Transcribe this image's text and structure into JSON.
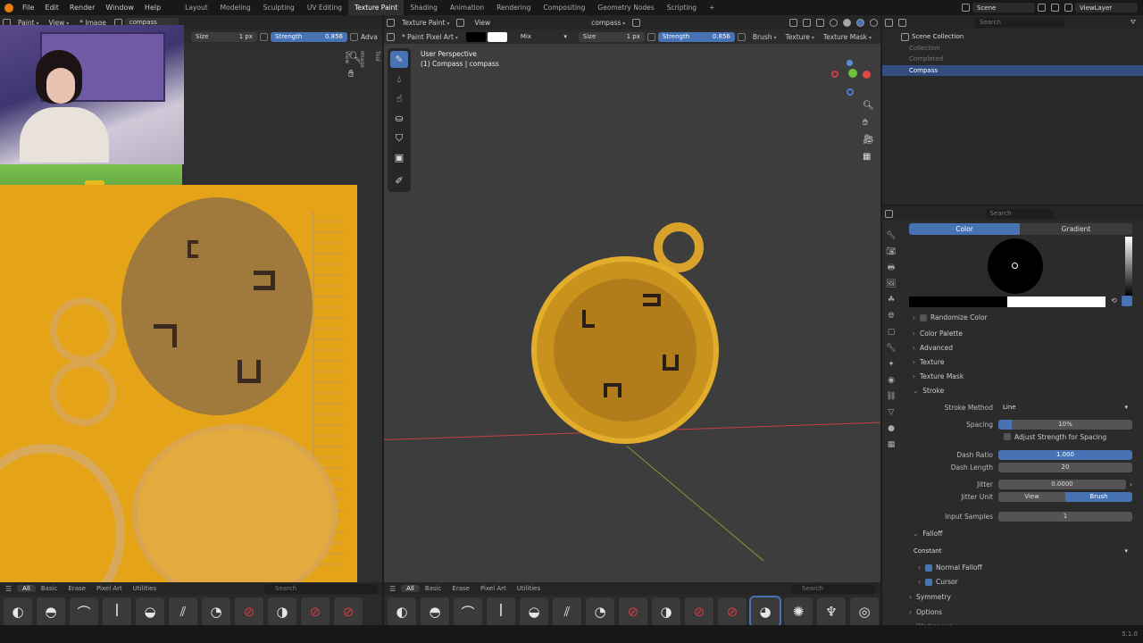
{
  "menu": [
    "File",
    "Edit",
    "Render",
    "Window",
    "Help"
  ],
  "workspaces": [
    "Layout",
    "Modeling",
    "Sculpting",
    "UV Editing",
    "Texture Paint",
    "Shading",
    "Animation",
    "Rendering",
    "Compositing",
    "Geometry Nodes",
    "Scripting"
  ],
  "active_workspace": "Texture Paint",
  "add_workspace": "+",
  "scene": "Scene",
  "view_layer": "ViewLayer",
  "image_editor": {
    "mode": "Paint",
    "view_menu": "View",
    "image_menu": "* Image",
    "image_name": "compass",
    "size_label": "Size",
    "size_value": "1 px",
    "strength_label": "Strength",
    "strength_value": "0.856",
    "adva_label": "Adva",
    "side_tabs": [
      "Tool",
      "Image",
      "View"
    ],
    "shelf_tabs": [
      "All",
      "Basic",
      "Erase",
      "Pixel Art",
      "Utilities"
    ],
    "search_placeholder": "Search",
    "brushes": [
      "brush-round",
      "brush-soft",
      "brush-hard",
      "brush-draw",
      "brush-airbrush",
      "brush-streak",
      "brush-smear",
      "brush-erase-hard",
      "brush-erase-soft",
      "brush-erase-pixel",
      "brush-erase-line"
    ]
  },
  "viewport": {
    "mode": "Texture Paint",
    "view_menu": "View",
    "object_dropdown": "compass",
    "brush_name": "* Paint Pixel Art",
    "blend": "Mix",
    "size_label": "Size",
    "size_value": "1 px",
    "strength_label": "Strength",
    "strength_value": "0.856",
    "brush_menu": "Brush",
    "texture_menu": "Texture",
    "texture_mask_menu": "Texture Mask",
    "overlay_title": "User Perspective",
    "overlay_sub": "(1) Compass | compass",
    "shelf_tabs": [
      "All",
      "Basic",
      "Erase",
      "Pixel Art",
      "Utilities"
    ],
    "search_placeholder": "Search",
    "brushes": [
      "brush-round",
      "brush-soft",
      "brush-hard",
      "brush-draw",
      "brush-airbrush",
      "brush-streak",
      "brush-smear",
      "brush-erase-hard",
      "brush-erase-soft",
      "brush-erase-pixel",
      "brush-erase-line",
      "brush-pixel-art",
      "brush-clone",
      "brush-fill",
      "brush-mask"
    ]
  },
  "outliner": {
    "search_placeholder": "Search",
    "root": "Scene Collection",
    "items": [
      "Collection",
      "Completed",
      "Compass"
    ]
  },
  "properties": {
    "search_placeholder": "Search",
    "color_tab": "Color",
    "gradient_tab": "Gradient",
    "randomize_color": "Randomize Color",
    "sections": [
      "Color Palette",
      "Advanced",
      "Texture",
      "Texture Mask"
    ],
    "stroke": "Stroke",
    "stroke_method_label": "Stroke Method",
    "stroke_method": "Line",
    "spacing_label": "Spacing",
    "spacing": "10%",
    "adjust_strength": "Adjust Strength for Spacing",
    "dash_ratio_label": "Dash Ratio",
    "dash_ratio": "1.000",
    "dash_length_label": "Dash Length",
    "dash_length": "20",
    "jitter_label": "Jitter",
    "jitter": "0.0000",
    "jitter_unit_label": "Jitter Unit",
    "jitter_unit_view": "View",
    "jitter_unit_brush": "Brush",
    "input_samples_label": "Input Samples",
    "input_samples": "1",
    "falloff": "Falloff",
    "falloff_type": "Constant",
    "normal_falloff": "Normal Falloff",
    "cursor": "Cursor",
    "symmetry": "Symmetry",
    "options": "Options",
    "workspace": "Workspace"
  },
  "version": "5.1.0",
  "colors": {
    "accent": "#4772b3",
    "yellow": "#e6a417",
    "header": "#252525"
  }
}
